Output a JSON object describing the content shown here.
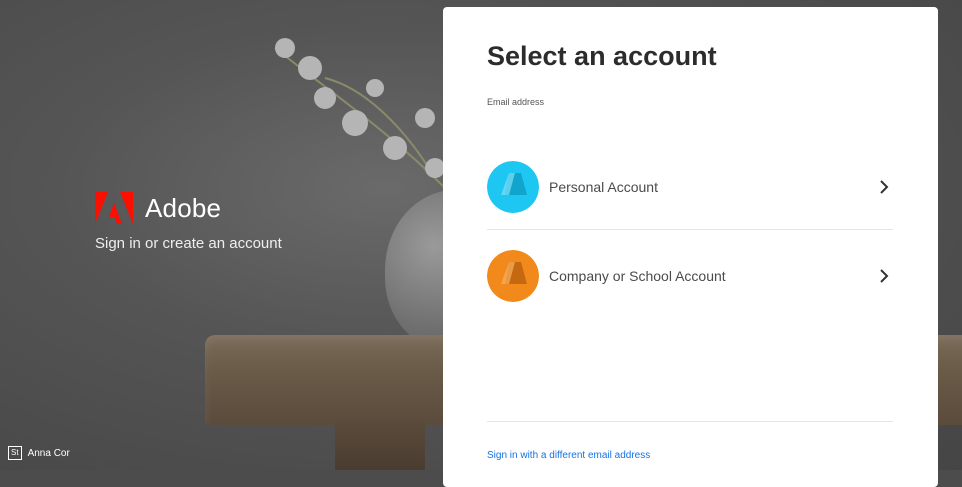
{
  "brand": {
    "name": "Adobe",
    "tagline": "Sign in or create an account"
  },
  "photo_credit": {
    "badge": "St",
    "name": "Anna Cor"
  },
  "card": {
    "title": "Select an account",
    "email_label": "Email address",
    "accounts": [
      {
        "label": "Personal Account",
        "color": "#1ec6f2",
        "shade": "#0fa0c8"
      },
      {
        "label": "Company or School Account",
        "color": "#f28a1b",
        "shade": "#c0650f"
      }
    ],
    "link": "Sign in with a different email address"
  },
  "colors": {
    "adobe_red": "#fa0f00",
    "link_blue": "#1473e6"
  }
}
